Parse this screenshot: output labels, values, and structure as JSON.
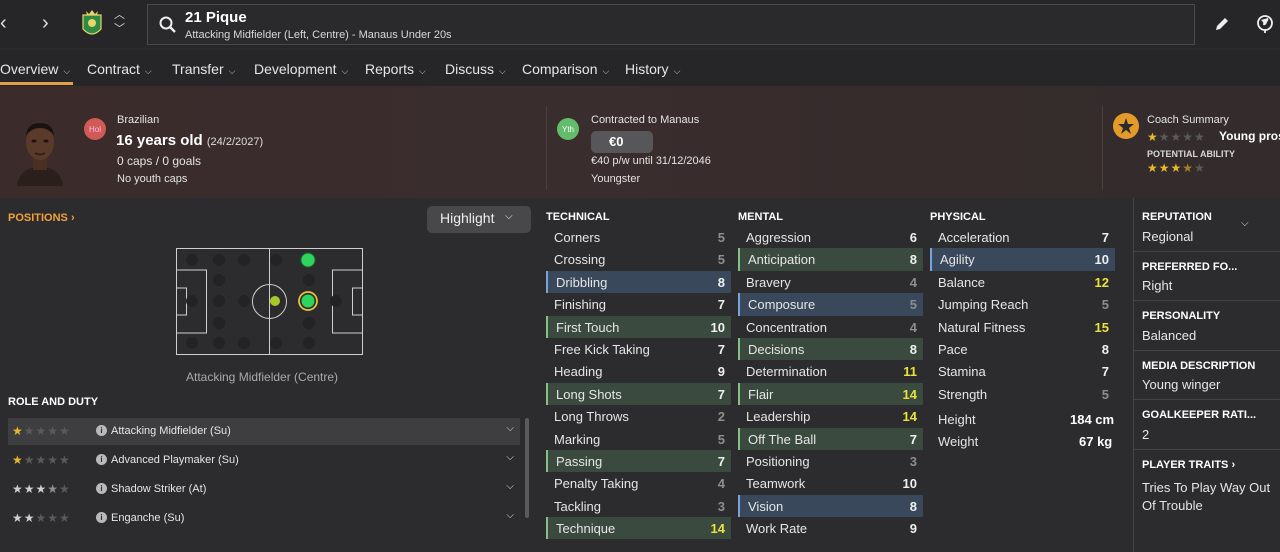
{
  "topbar": {
    "title": "21 Pique",
    "subtitle": "Attacking Midfielder (Left, Centre) - Manaus Under 20s"
  },
  "tabs": [
    "Overview",
    "Contract",
    "Transfer",
    "Development",
    "Reports",
    "Discuss",
    "Comparison",
    "History"
  ],
  "header": {
    "nationality_badge": "Hol",
    "nationality": "Brazilian",
    "age": "16 years old",
    "dob": "(24/2/2027)",
    "caps": "0 caps / 0 goals",
    "youth_caps": "No youth caps",
    "contract_badge": "Yth",
    "contracted_to": "Contracted to Manaus",
    "value": "€0",
    "wage": "€40 p/w until 31/12/2046",
    "contract_type": "Youngster",
    "coach_summary_label": "Coach Summary",
    "coach_summary_text": "Young pros",
    "current_ability_stars": 1,
    "potential_label": "POTENTIAL ABILITY",
    "potential_ability_stars": 3.5
  },
  "positions": {
    "label": "POSITIONS",
    "highlight_label": "Highlight",
    "caption": "Attacking Midfielder (Centre)"
  },
  "roles": {
    "label": "ROLE AND DUTY",
    "items": [
      {
        "name": "Attacking Midfielder (Su)",
        "stars": 1
      },
      {
        "name": "Advanced Playmaker (Su)",
        "stars": 1
      },
      {
        "name": "Shadow Striker (At)",
        "stars": 3.5
      },
      {
        "name": "Enganche (Su)",
        "stars": 2
      }
    ]
  },
  "technical": {
    "label": "TECHNICAL",
    "items": [
      {
        "name": "Corners",
        "value": 5,
        "hl": ""
      },
      {
        "name": "Crossing",
        "value": 5,
        "hl": ""
      },
      {
        "name": "Dribbling",
        "value": 8,
        "hl": "b"
      },
      {
        "name": "Finishing",
        "value": 7,
        "hl": ""
      },
      {
        "name": "First Touch",
        "value": 10,
        "hl": "g"
      },
      {
        "name": "Free Kick Taking",
        "value": 7,
        "hl": ""
      },
      {
        "name": "Heading",
        "value": 9,
        "hl": ""
      },
      {
        "name": "Long Shots",
        "value": 7,
        "hl": "g"
      },
      {
        "name": "Long Throws",
        "value": 2,
        "hl": ""
      },
      {
        "name": "Marking",
        "value": 5,
        "hl": ""
      },
      {
        "name": "Passing",
        "value": 7,
        "hl": "g"
      },
      {
        "name": "Penalty Taking",
        "value": 4,
        "hl": ""
      },
      {
        "name": "Tackling",
        "value": 3,
        "hl": ""
      },
      {
        "name": "Technique",
        "value": 14,
        "hl": "g"
      }
    ]
  },
  "mental": {
    "label": "MENTAL",
    "items": [
      {
        "name": "Aggression",
        "value": 6,
        "hl": ""
      },
      {
        "name": "Anticipation",
        "value": 8,
        "hl": "g"
      },
      {
        "name": "Bravery",
        "value": 4,
        "hl": ""
      },
      {
        "name": "Composure",
        "value": 5,
        "hl": "b"
      },
      {
        "name": "Concentration",
        "value": 4,
        "hl": ""
      },
      {
        "name": "Decisions",
        "value": 8,
        "hl": "g"
      },
      {
        "name": "Determination",
        "value": 11,
        "hl": ""
      },
      {
        "name": "Flair",
        "value": 14,
        "hl": "g"
      },
      {
        "name": "Leadership",
        "value": 14,
        "hl": ""
      },
      {
        "name": "Off The Ball",
        "value": 7,
        "hl": "g"
      },
      {
        "name": "Positioning",
        "value": 3,
        "hl": ""
      },
      {
        "name": "Teamwork",
        "value": 10,
        "hl": ""
      },
      {
        "name": "Vision",
        "value": 8,
        "hl": "b"
      },
      {
        "name": "Work Rate",
        "value": 9,
        "hl": ""
      }
    ]
  },
  "physical": {
    "label": "PHYSICAL",
    "items": [
      {
        "name": "Acceleration",
        "value": 7,
        "hl": ""
      },
      {
        "name": "Agility",
        "value": 10,
        "hl": "b"
      },
      {
        "name": "Balance",
        "value": 12,
        "hl": ""
      },
      {
        "name": "Jumping Reach",
        "value": 5,
        "hl": ""
      },
      {
        "name": "Natural Fitness",
        "value": 15,
        "hl": ""
      },
      {
        "name": "Pace",
        "value": 8,
        "hl": ""
      },
      {
        "name": "Stamina",
        "value": 7,
        "hl": ""
      },
      {
        "name": "Strength",
        "value": 5,
        "hl": ""
      }
    ],
    "height_label": "Height",
    "height": "184 cm",
    "weight_label": "Weight",
    "weight": "67 kg"
  },
  "side": {
    "reputation_label": "REPUTATION",
    "reputation": "Regional",
    "foot_label": "PREFERRED FO...",
    "foot": "Right",
    "personality_label": "PERSONALITY",
    "personality": "Balanced",
    "media_label": "MEDIA DESCRIPTION",
    "media": "Young winger",
    "gk_label": "GOALKEEPER RATI...",
    "gk": "2",
    "traits_label": "PLAYER TRAITS",
    "trait1": "Tries To Play Way Out",
    "trait2": "Of Trouble"
  },
  "colors": {
    "accent": "#e2a04c",
    "green_highlight": "#3b4a3f",
    "blue_highlight": "#39485a",
    "high_value": "#e9e23a"
  }
}
